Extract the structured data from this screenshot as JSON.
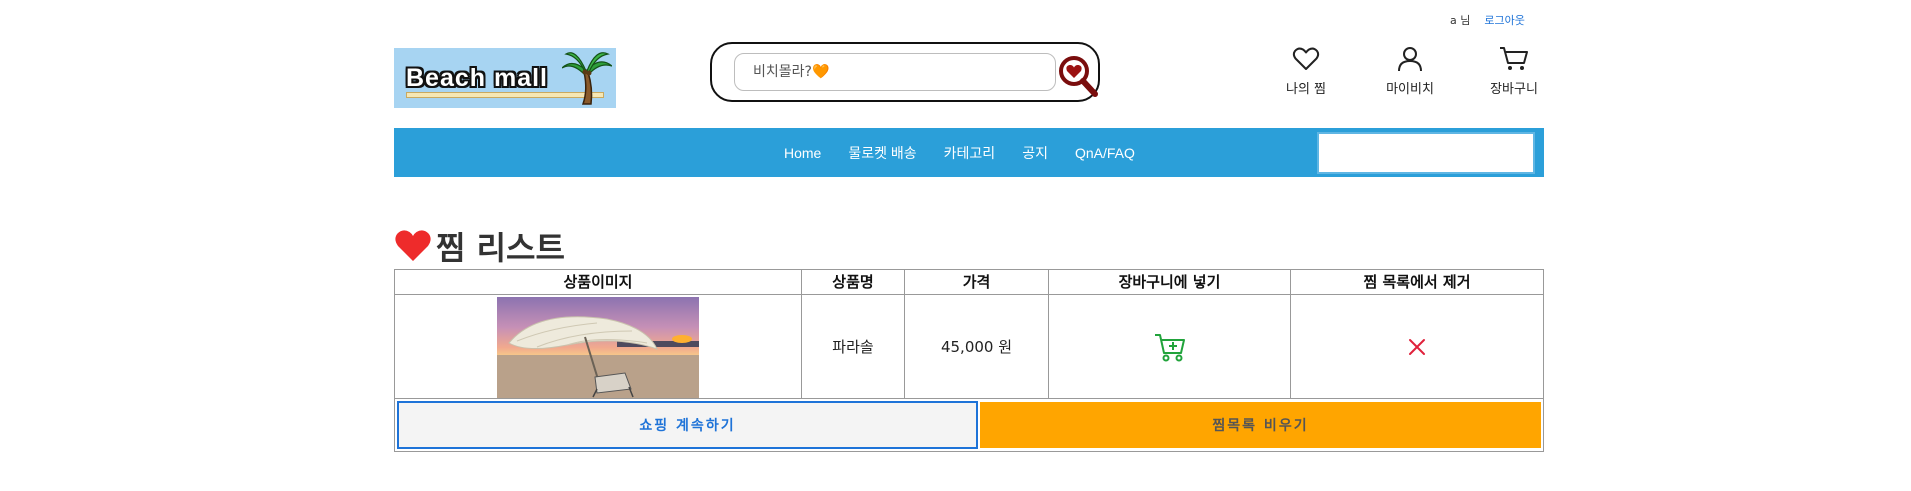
{
  "auth": {
    "username": "a 님",
    "logout": "로그아웃"
  },
  "logo": {
    "text": "Beach mall"
  },
  "search": {
    "placeholder": "비치몰라?🧡",
    "value": ""
  },
  "header_links": [
    {
      "label": "나의 찜",
      "icon": "heart-icon"
    },
    {
      "label": "마이비치",
      "icon": "user-icon"
    },
    {
      "label": "장바구니",
      "icon": "cart-icon"
    }
  ],
  "nav": {
    "items": [
      "Home",
      "물로켓 배송",
      "카테고리",
      "공지",
      "QnA/FAQ"
    ],
    "search_value": ""
  },
  "page": {
    "title": "찜 리스트"
  },
  "table": {
    "headers": [
      "상품이미지",
      "상품명",
      "가격",
      "장바구니에 넣기",
      "찜 목록에서 제거"
    ],
    "rows": [
      {
        "name": "파라솔",
        "price": "45,000 원"
      }
    ]
  },
  "buttons": {
    "continue": "쇼핑 계속하기",
    "clear": "찜목록 비우기"
  },
  "colors": {
    "nav": "#2b9fd9",
    "accent_blue": "#1e73d8",
    "clear_button": "#ffa500",
    "cart_green": "#21a33b",
    "remove_red": "#e0213b",
    "title_heart": "#ee2b2b"
  }
}
